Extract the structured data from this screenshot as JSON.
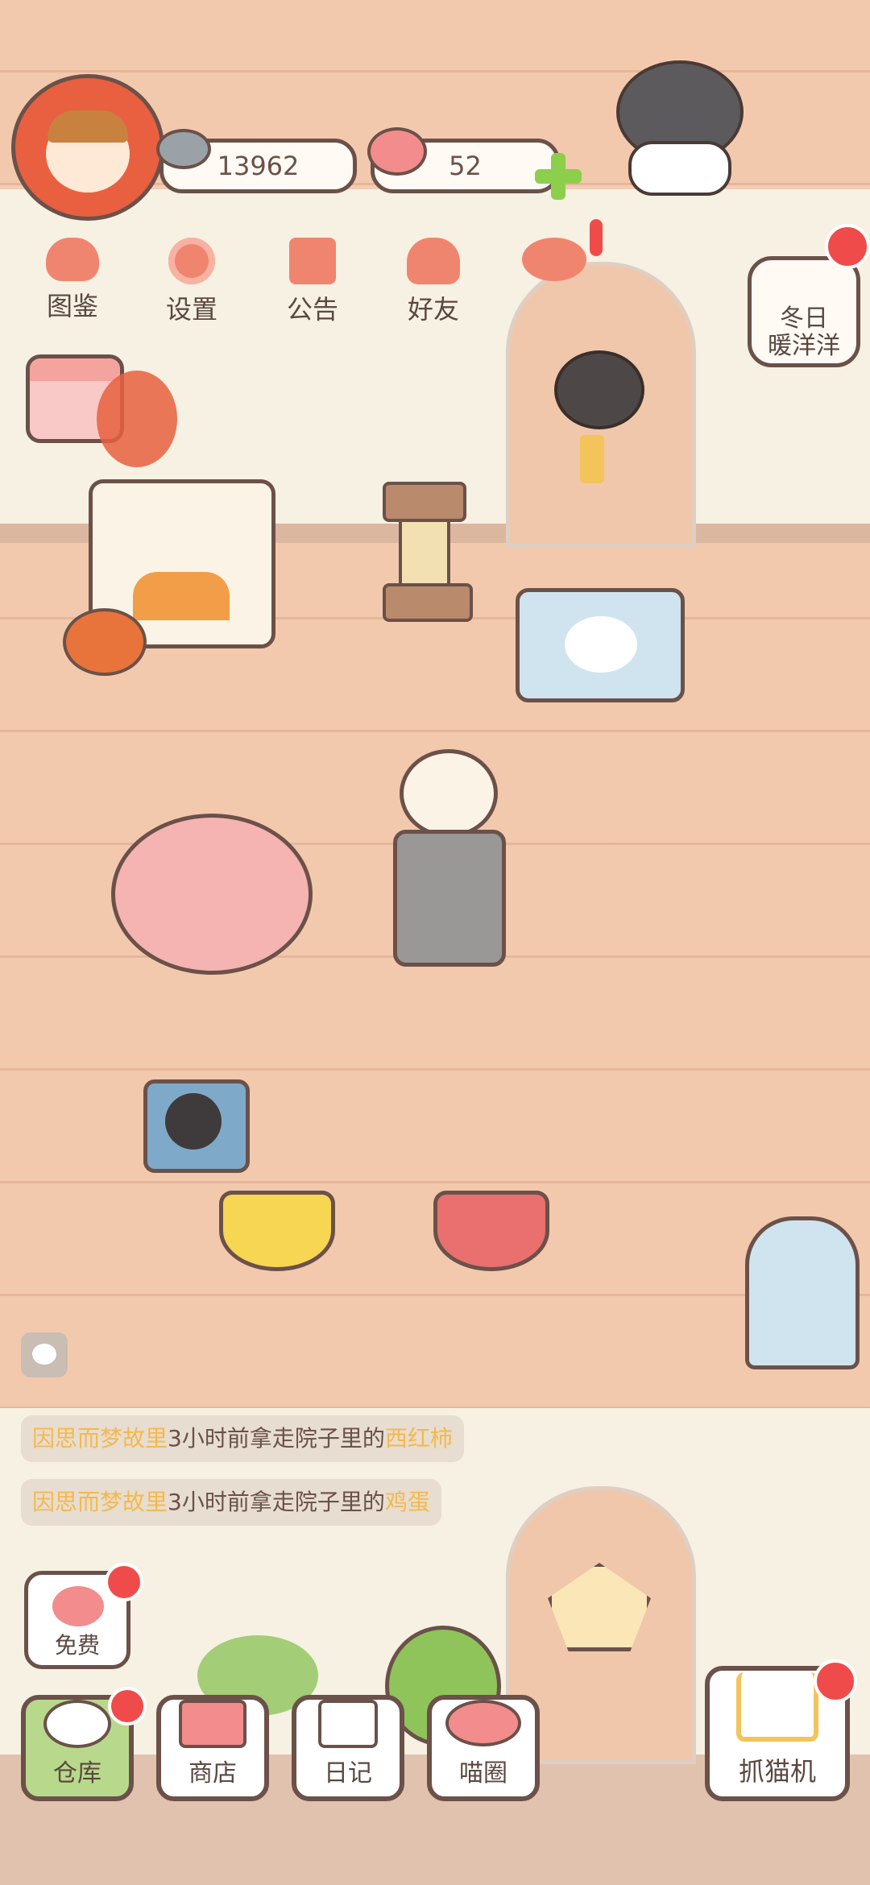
{
  "currency": {
    "coins": "13962",
    "hearts": "52"
  },
  "top_menu": [
    {
      "label": "图鉴",
      "icon": "cat-book-icon"
    },
    {
      "label": "设置",
      "icon": "gear-icon"
    },
    {
      "label": "公告",
      "icon": "gift-icon"
    },
    {
      "label": "好友",
      "icon": "friends-icon"
    },
    {
      "label": "",
      "icon": "hearts-icon"
    }
  ],
  "event": {
    "line1": "冬日",
    "line2": "暖洋洋"
  },
  "feed": [
    {
      "user": "因思而梦故里",
      "text": "3小时前拿走院子里的",
      "item": "西红柿"
    },
    {
      "user": "因思而梦故里",
      "text": "3小时前拿走院子里的",
      "item": "鸡蛋"
    }
  ],
  "free_button": {
    "label": "免费"
  },
  "dock": [
    {
      "label": "仓库"
    },
    {
      "label": "商店"
    },
    {
      "label": "日记"
    },
    {
      "label": "喵圈"
    }
  ],
  "claw_machine": {
    "label": "抓猫机"
  },
  "colors": {
    "wall": "#f6f1e3",
    "floor": "#f3c9ae",
    "outline": "#6b5149",
    "accent_red": "#f04b4b",
    "highlight_text": "#f4b94d",
    "green_plus": "#8bcf4a"
  }
}
